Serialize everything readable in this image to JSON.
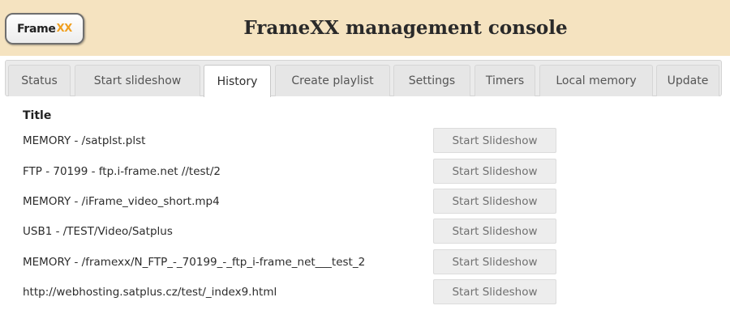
{
  "logo": {
    "text": "Frame",
    "mark": "XX"
  },
  "header": {
    "title": "FrameXX management console"
  },
  "tabs": [
    {
      "label": "Status",
      "active": false
    },
    {
      "label": "Start slideshow",
      "active": false
    },
    {
      "label": "History",
      "active": true
    },
    {
      "label": "Create playlist",
      "active": false
    },
    {
      "label": "Settings",
      "active": false
    },
    {
      "label": "Timers",
      "active": false
    },
    {
      "label": "Local memory",
      "active": false
    },
    {
      "label": "Update",
      "active": false
    }
  ],
  "history": {
    "column_title": "Title",
    "rows": [
      {
        "title": "MEMORY - /satplst.plst",
        "button": "Start Slideshow"
      },
      {
        "title": "FTP - 70199 - ftp.i-frame.net //test/2",
        "button": "Start Slideshow"
      },
      {
        "title": "MEMORY - /iFrame_video_short.mp4",
        "button": "Start Slideshow"
      },
      {
        "title": "USB1 - /TEST/Video/Satplus",
        "button": "Start Slideshow"
      },
      {
        "title": "MEMORY - /framexx/N_FTP_-_70199_-_ftp_i-frame_net___test_2",
        "button": "Start Slideshow"
      },
      {
        "title": "http://webhosting.satplus.cz/test/_index9.html",
        "button": "Start Slideshow"
      }
    ]
  }
}
